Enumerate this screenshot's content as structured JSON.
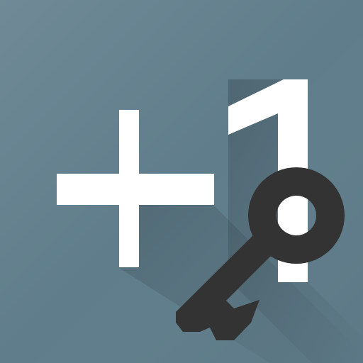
{
  "app_icon": {
    "glyph_text": "+1",
    "background_color": "#607D8B",
    "glyph_color": "#FFFFFF",
    "shadow_color": "#263238",
    "key_color": "#333333",
    "icon_names": [
      "plus-one-icon",
      "key-icon"
    ]
  }
}
